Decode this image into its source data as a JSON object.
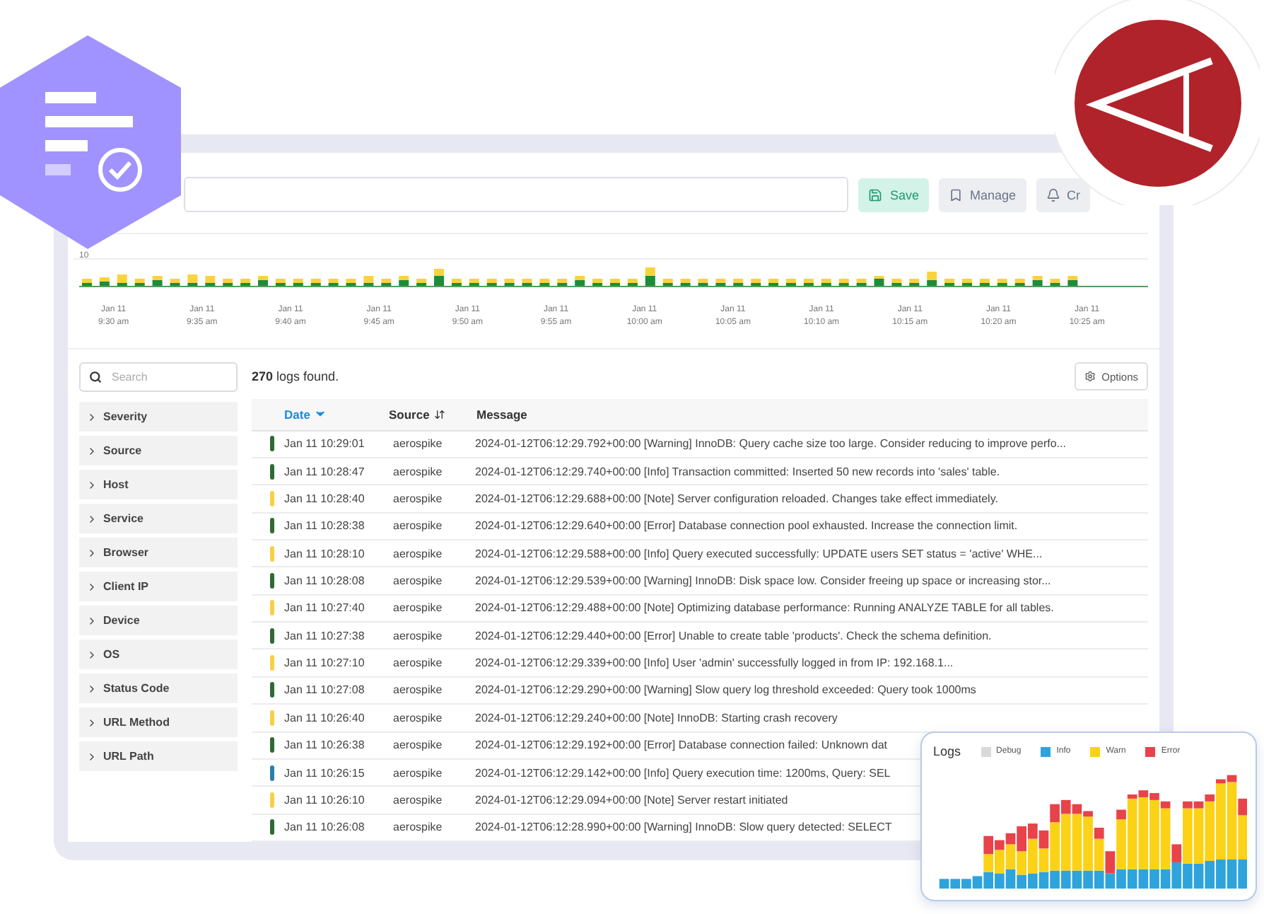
{
  "toolbar": {
    "buttons": [
      {
        "label": "Save",
        "kind": "save"
      },
      {
        "label": "Manage",
        "kind": "manage"
      },
      {
        "label": "Cr",
        "kind": "alert"
      }
    ]
  },
  "histogram": {
    "y_tick": "10",
    "labels": [
      {
        "date": "Jan 11",
        "time": "9:30 am"
      },
      {
        "date": "Jan 11",
        "time": "9:35 am"
      },
      {
        "date": "Jan 11",
        "time": "9:40 am"
      },
      {
        "date": "Jan 11",
        "time": "9:45 am"
      },
      {
        "date": "Jan 11",
        "time": "9:50 am"
      },
      {
        "date": "Jan 11",
        "time": "9:55 am"
      },
      {
        "date": "Jan 11",
        "time": "10:00 am"
      },
      {
        "date": "Jan 11",
        "time": "10:05 am"
      },
      {
        "date": "Jan 11",
        "time": "10:10 am"
      },
      {
        "date": "Jan 11",
        "time": "10:15 am"
      },
      {
        "date": "Jan 11",
        "time": "10:20 am"
      },
      {
        "date": "Jan 11",
        "time": "10:25 am"
      }
    ]
  },
  "sidebar": {
    "search": {
      "placeholder": "Search"
    },
    "filters": [
      {
        "label": "Severity",
        "expanded": false
      },
      {
        "label": "Source",
        "expanded": false
      },
      {
        "label": "Host",
        "expanded": false
      },
      {
        "label": "Service",
        "expanded": false
      },
      {
        "label": "Browser",
        "expanded": false
      },
      {
        "label": "Client IP",
        "expanded": false
      },
      {
        "label": "Device",
        "expanded": false
      },
      {
        "label": "OS",
        "expanded": false
      },
      {
        "label": "Status Code",
        "expanded": false
      },
      {
        "label": "URL Method",
        "expanded": false
      },
      {
        "label": "URL Path",
        "expanded": false
      }
    ]
  },
  "results": {
    "count": "**270** logs found.",
    "options_button": "Options"
  },
  "table": {
    "columns": [
      {
        "label": "Date",
        "sortable": true,
        "selected": true
      },
      {
        "label": "Source",
        "sortable": true,
        "selected": false
      },
      {
        "label": "Message",
        "sortable": false,
        "selected": false
      }
    ],
    "rows": [
      {
        "color": "#2e6b34",
        "date": "Jan 11 10:29:01",
        "source": "aerospike",
        "message": "2024-01-12T06:12:29.792+00:00 [Warning] InnoDB: Query cache size too large. Consider reducing to improve perfo..."
      },
      {
        "color": "#2e6b34",
        "date": "Jan 11 10:28:47",
        "source": "aerospike",
        "message": "2024-01-12T06:12:29.740+00:00 [Info] Transaction committed: Inserted 50 new records into 'sales' table."
      },
      {
        "color": "#f7d046",
        "date": "Jan 11 10:28:40",
        "source": "aerospike",
        "message": "2024-01-12T06:12:29.688+00:00 [Note] Server configuration reloaded. Changes take effect immediately."
      },
      {
        "color": "#2e6b34",
        "date": "Jan 11 10:28:38",
        "source": "aerospike",
        "message": "2024-01-12T06:12:29.640+00:00 [Error] Database connection pool exhausted. Increase the connection limit."
      },
      {
        "color": "#f7d046",
        "date": "Jan 11 10:28:10",
        "source": "aerospike",
        "message": "2024-01-12T06:12:29.588+00:00 [Info] Query executed successfully: UPDATE users SET status = 'active' WHE..."
      },
      {
        "color": "#2e6b34",
        "date": "Jan 11 10:28:08",
        "source": "aerospike",
        "message": "2024-01-12T06:12:29.539+00:00 [Warning] InnoDB: Disk space low. Consider freeing up space or increasing stor..."
      },
      {
        "color": "#f7d046",
        "date": "Jan 11 10:27:40",
        "source": "aerospike",
        "message": "2024-01-12T06:12:29.488+00:00 [Note] Optimizing database performance: Running ANALYZE TABLE for all tables."
      },
      {
        "color": "#2e6b34",
        "date": "Jan 11 10:27:38",
        "source": "aerospike",
        "message": "2024-01-12T06:12:29.440+00:00 [Error] Unable to create table 'products'. Check the schema definition."
      },
      {
        "color": "#f7d046",
        "date": "Jan 11 10:27:10",
        "source": "aerospike",
        "message": "2024-01-12T06:12:29.339+00:00 [Info] User 'admin' successfully logged in from IP: 192.168.1..."
      },
      {
        "color": "#2e6b34",
        "date": "Jan 11 10:27:08",
        "source": "aerospike",
        "message": "2024-01-12T06:12:29.290+00:00 [Warning] Slow query log threshold exceeded: Query took 1000ms"
      },
      {
        "color": "#f7d046",
        "date": "Jan 11 10:26:40",
        "source": "aerospike",
        "message": "2024-01-12T06:12:29.240+00:00 [Note] InnoDB: Starting crash recovery"
      },
      {
        "color": "#2e6b34",
        "date": "Jan 11 10:26:38",
        "source": "aerospike",
        "message": "2024-01-12T06:12:29.192+00:00 [Error] Database connection failed: Unknown dat"
      },
      {
        "color": "#2a7fa8",
        "date": "Jan 11 10:26:15",
        "source": "aerospike",
        "message": "2024-01-12T06:12:29.142+00:00 [Info] Query execution time: 1200ms, Query: SEL"
      },
      {
        "color": "#f7d046",
        "date": "Jan 11 10:26:10",
        "source": "aerospike",
        "message": "2024-01-12T06:12:29.094+00:00 [Note] Server restart initiated"
      },
      {
        "color": "#2e6b34",
        "date": "Jan 11 10:26:08",
        "source": "aerospike",
        "message": "2024-01-12T06:12:28.990+00:00 [Warning] InnoDB: Slow query detected: SELECT"
      }
    ]
  },
  "logs_card": {
    "title": "Logs",
    "legend": [
      {
        "label": "Debug",
        "color": "#d9d9d9"
      },
      {
        "label": "Info",
        "color": "#2ea3dc"
      },
      {
        "label": "Warn",
        "color": "#fbd216"
      },
      {
        "label": "Error",
        "color": "#e8424a"
      }
    ]
  }
}
